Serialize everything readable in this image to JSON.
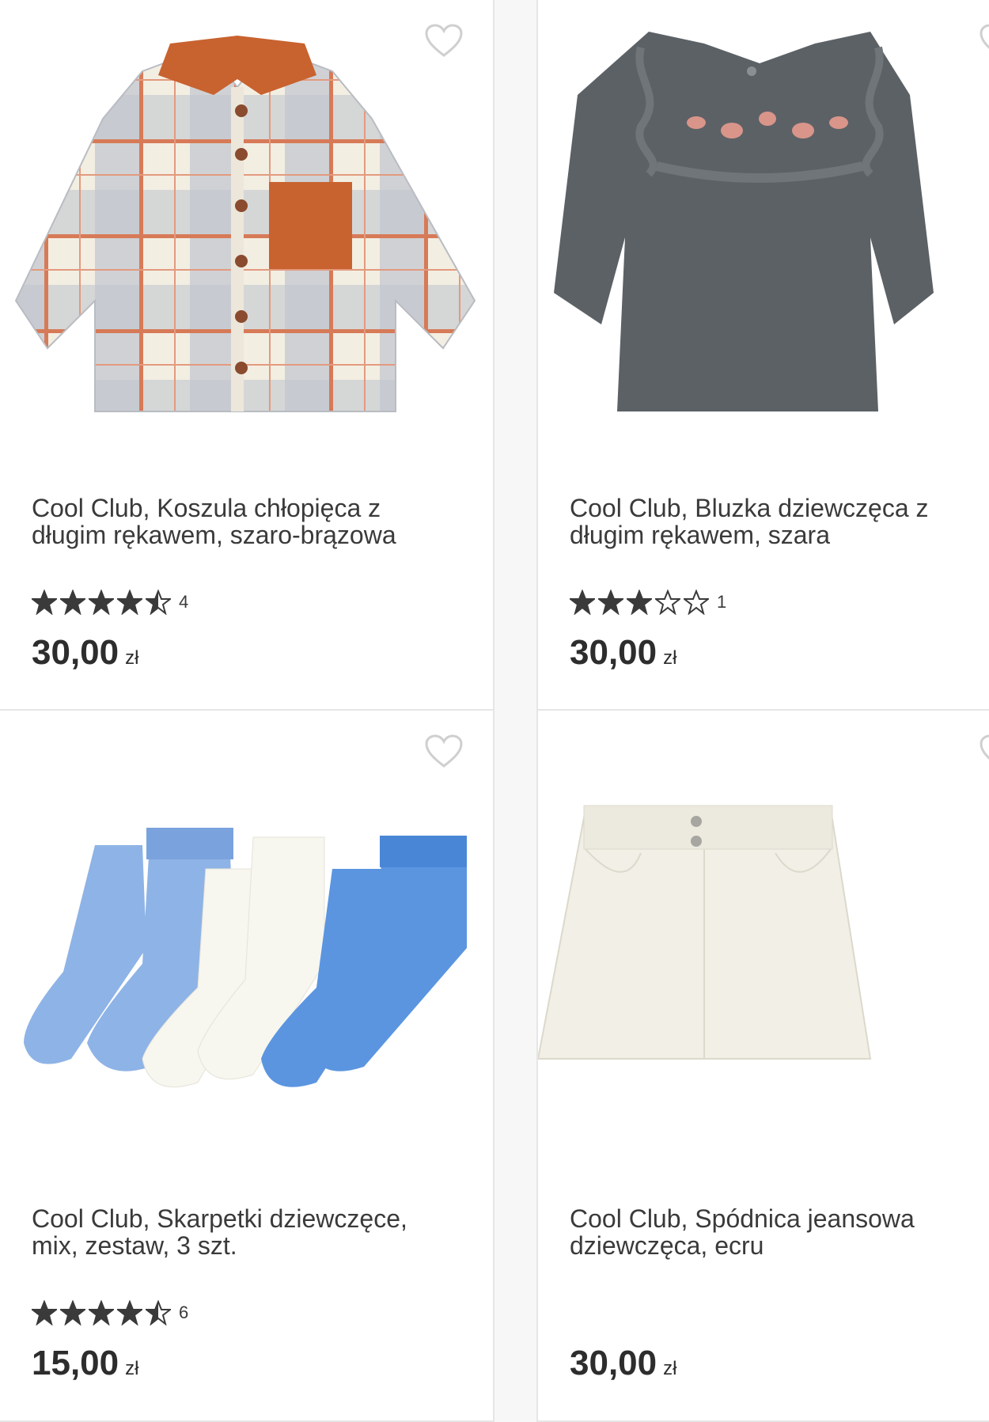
{
  "products": [
    {
      "title": "Cool Club, Koszula chłopięca z długim rękawem, szaro-brązowa",
      "rating": 4.5,
      "review_count": "4",
      "price": "30,00",
      "currency": "zł",
      "image": "plaid-shirt"
    },
    {
      "title": "Cool Club, Bluzka dziewczęca z długim rękawem, szara",
      "rating": 3,
      "review_count": "1",
      "price": "30,00",
      "currency": "zł",
      "image": "grey-blouse"
    },
    {
      "title": "Cool Club, Skarpetki dziewczęce, mix, zestaw, 3 szt.",
      "rating": 4.5,
      "review_count": "6",
      "price": "15,00",
      "currency": "zł",
      "image": "socks-set"
    },
    {
      "title": "Cool Club, Spódnica jeansowa dziewczęca, ecru",
      "rating": null,
      "review_count": "",
      "price": "30,00",
      "currency": "zł",
      "image": "ecru-skirt"
    }
  ],
  "icons": {
    "favorite": "heart-outline-icon",
    "star": "star-icon"
  },
  "colors": {
    "star": "#3a3a3a",
    "border": "#e6e6e6"
  }
}
